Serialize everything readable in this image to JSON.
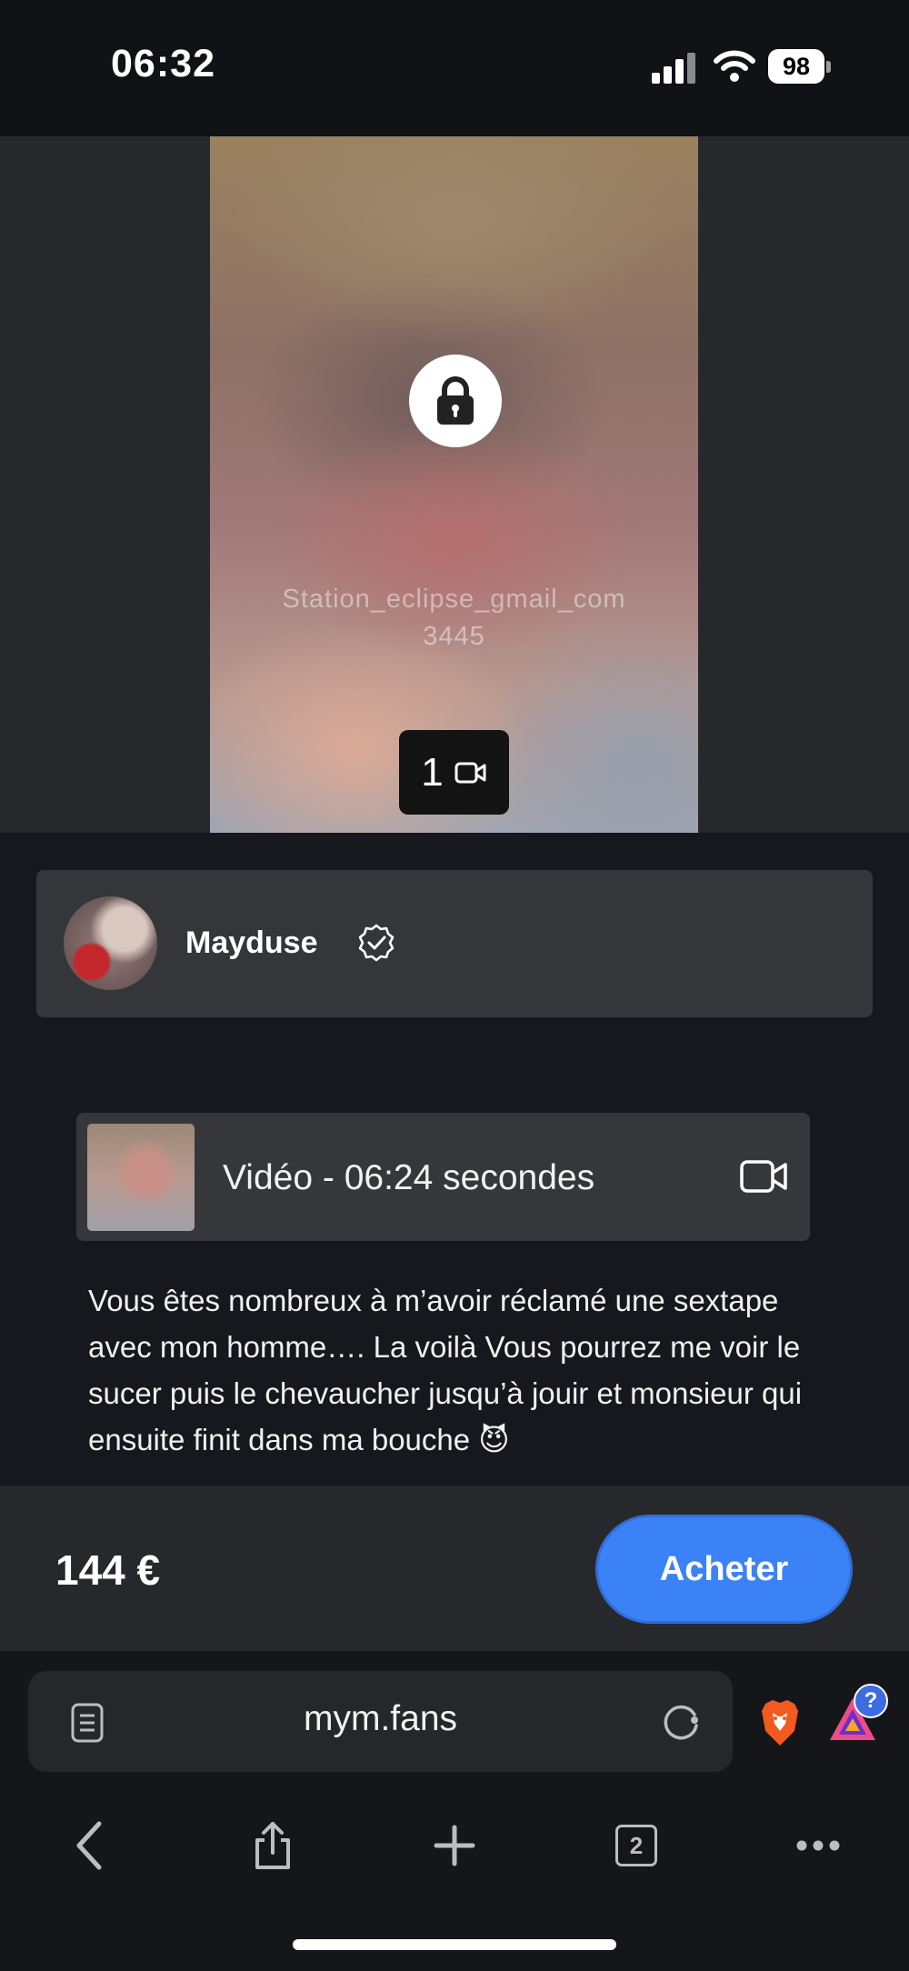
{
  "status_bar": {
    "time": "06:32",
    "battery_level": "98",
    "icons": [
      "signal-icon",
      "wifi-icon",
      "battery-icon"
    ]
  },
  "media": {
    "icon": "lock-icon",
    "watermark_line1": "Station_eclipse_gmail_com",
    "watermark_line2": "3445",
    "media_count": "1",
    "media_type_icon": "video-camera-icon"
  },
  "creator": {
    "name": "Mayduse",
    "verified_icon": "verified-badge-icon"
  },
  "video_item": {
    "label": "Vidéo - 06:24 secondes",
    "icon": "video-camera-icon"
  },
  "post": {
    "description": "Vous êtes nombreux à m’avoir réclamé une sextape avec mon homme…. La voilà Vous pourrez me voir le sucer puis le chevaucher jusqu’à jouir et monsieur qui ensuite finit dans ma bouche 😈"
  },
  "purchase": {
    "price": "144 €",
    "buy_label": "Acheter",
    "accent_color": "#3b82f6"
  },
  "browser": {
    "url": "mym.fans",
    "tab_count": "2",
    "help_badge": "?",
    "toolbar_icons": [
      "back-icon",
      "share-icon",
      "plus-icon",
      "tabs-icon",
      "more-icon"
    ]
  }
}
